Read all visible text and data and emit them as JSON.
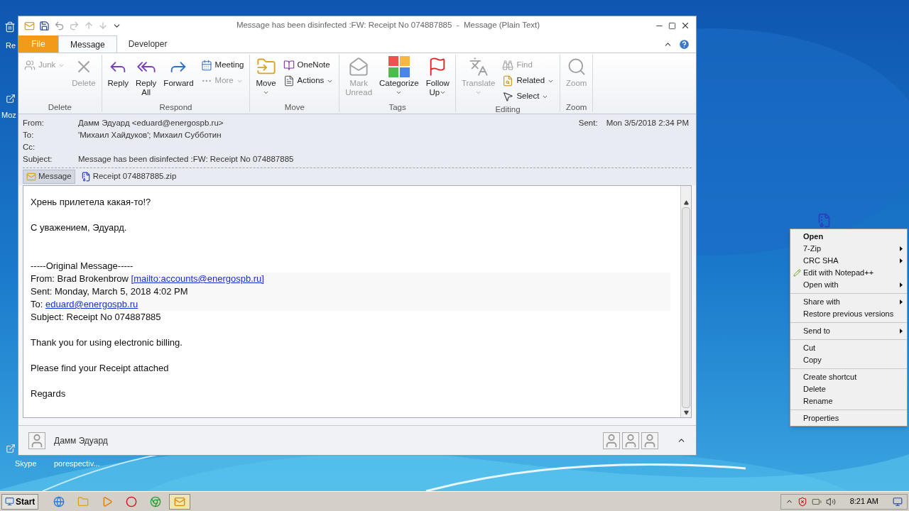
{
  "desktop_icons": [
    {
      "label": "Re",
      "kind": "bin"
    },
    {
      "label": "Moz",
      "kind": "shortcut"
    },
    {
      "label": "Skype",
      "kind": "shortcut"
    },
    {
      "label": "porespectiv...",
      "kind": "hidden_icon"
    }
  ],
  "window": {
    "title": "Message has been disinfected :FW: Receipt No 074887885  -  Message (Plain Text)",
    "tabs": [
      {
        "label": "File",
        "kind": "file",
        "selected": false
      },
      {
        "label": "Message",
        "kind": "tab",
        "selected": true
      },
      {
        "label": "Developer",
        "kind": "tab",
        "selected": false
      }
    ],
    "ribbon": [
      {
        "label": "Delete",
        "items": [
          {
            "label": "Junk",
            "kind": "small",
            "disabled": true,
            "dropdown": true
          },
          {
            "label": "Delete",
            "kind": "large",
            "disabled": true,
            "dropdown": false
          }
        ]
      },
      {
        "label": "Respond",
        "items": [
          {
            "label": "Reply",
            "kind": "large",
            "disabled": false,
            "dropdown": false
          },
          {
            "label": "Reply All",
            "kind": "large",
            "disabled": false,
            "dropdown": false
          },
          {
            "label": "Forward",
            "kind": "large",
            "disabled": false,
            "dropdown": false
          },
          {
            "label": "Meeting",
            "kind": "small",
            "disabled": false,
            "dropdown": false
          },
          {
            "label": "More",
            "kind": "small",
            "disabled": true,
            "dropdown": true
          }
        ]
      },
      {
        "label": "Move",
        "items": [
          {
            "label": "Move",
            "kind": "large",
            "disabled": false,
            "dropdown": true
          },
          {
            "label": "OneNote",
            "kind": "small",
            "disabled": false,
            "dropdown": false
          },
          {
            "label": "Actions",
            "kind": "small",
            "disabled": false,
            "dropdown": true
          }
        ]
      },
      {
        "label": "Tags",
        "items": [
          {
            "label": "Mark Unread",
            "kind": "large",
            "disabled": true,
            "dropdown": false
          },
          {
            "label": "Categorize",
            "kind": "large",
            "disabled": false,
            "dropdown": true
          },
          {
            "label": "Follow Up",
            "kind": "large",
            "disabled": false,
            "dropdown": true
          }
        ]
      },
      {
        "label": "Editing",
        "items": [
          {
            "label": "Translate",
            "kind": "large",
            "disabled": true,
            "dropdown": true
          },
          {
            "label": "Find",
            "kind": "small",
            "disabled": true,
            "dropdown": false
          },
          {
            "label": "Related",
            "kind": "small",
            "disabled": false,
            "dropdown": true
          },
          {
            "label": "Select",
            "kind": "small",
            "disabled": false,
            "dropdown": true
          }
        ]
      },
      {
        "label": "Zoom",
        "items": [
          {
            "label": "Zoom",
            "kind": "large",
            "disabled": true,
            "dropdown": false
          }
        ]
      }
    ],
    "header": {
      "fields": [
        {
          "label": "From:",
          "value": "Дамм Эдуард <eduard@energospb.ru>"
        },
        {
          "label": "To:",
          "value": "'Михаил Хайдуков'; Михаил Субботин"
        },
        {
          "label": "Cc:"
        },
        {
          "label": "Subject:",
          "value": "Message has been disinfected :FW: Receipt No 074887885"
        }
      ],
      "sent_label": "Sent:",
      "sent_value": "Mon 3/5/2018 2:34 PM"
    },
    "attachments": [
      {
        "label": "Message",
        "kind": "message",
        "selected": true
      },
      {
        "label": "Receipt 074887885.zip",
        "kind": "zip",
        "selected": false
      }
    ],
    "body": [
      {
        "kind": "text",
        "lines": [
          {
            "text": "Хрень прилетела какая-то!?"
          }
        ]
      },
      {
        "kind": "text",
        "lines": [
          {
            "text": "С уважением, Эдуард."
          }
        ]
      },
      {
        "kind": "quoted",
        "lines": [
          {
            "text": "-----Original Message-----"
          },
          {
            "text": "From: Brad Brokenbrow ",
            "link": "[mailto:accounts@energospb.ru]"
          },
          {
            "text": "Sent: Monday, March 5, 2018 4:02 PM"
          },
          {
            "text": "To: ",
            "link": "eduard@energospb.ru"
          },
          {
            "text": "Subject: Receipt No 074887885"
          }
        ]
      },
      {
        "kind": "text",
        "lines": [
          {
            "text": "Thank you for using electronic billing."
          }
        ]
      },
      {
        "kind": "text",
        "lines": [
          {
            "text": "Please find your Receipt attached"
          }
        ]
      },
      {
        "kind": "text",
        "lines": [
          {
            "text": "Regards"
          }
        ]
      }
    ],
    "people_pane": {
      "name": "Дамм Эдуард"
    }
  },
  "context_menu": [
    [
      {
        "label": "Open",
        "bold": true,
        "submenu": false,
        "kind": "plain"
      },
      {
        "label": "7-Zip",
        "bold": false,
        "submenu": true,
        "kind": "plain"
      },
      {
        "label": "CRC SHA",
        "bold": false,
        "submenu": true,
        "kind": "plain"
      },
      {
        "label": "Edit with Notepad++",
        "bold": false,
        "submenu": false,
        "kind": "with_icon"
      },
      {
        "label": "Open with",
        "bold": false,
        "submenu": true,
        "kind": "plain"
      }
    ],
    [
      {
        "label": "Share with",
        "bold": false,
        "submenu": true,
        "kind": "plain"
      },
      {
        "label": "Restore previous versions",
        "bold": false,
        "submenu": false,
        "kind": "plain"
      }
    ],
    [
      {
        "label": "Send to",
        "bold": false,
        "submenu": true,
        "kind": "plain"
      }
    ],
    [
      {
        "label": "Cut",
        "bold": false,
        "submenu": false,
        "kind": "plain"
      },
      {
        "label": "Copy",
        "bold": false,
        "submenu": false,
        "kind": "plain"
      }
    ],
    [
      {
        "label": "Create shortcut",
        "bold": false,
        "submenu": false,
        "kind": "plain"
      },
      {
        "label": "Delete",
        "bold": false,
        "submenu": false,
        "kind": "plain"
      },
      {
        "label": "Rename",
        "bold": false,
        "submenu": false,
        "kind": "plain"
      }
    ],
    [
      {
        "label": "Properties",
        "bold": false,
        "submenu": false,
        "kind": "plain"
      }
    ]
  ],
  "taskbar": {
    "start": "Start",
    "apps": [
      {
        "kind": "ie",
        "selected": false
      },
      {
        "kind": "explorer",
        "selected": false
      },
      {
        "kind": "media",
        "selected": false
      },
      {
        "kind": "opera",
        "selected": false
      },
      {
        "kind": "chrome",
        "selected": false
      },
      {
        "kind": "outlook",
        "selected": true
      }
    ],
    "clock": "8:21 AM"
  }
}
